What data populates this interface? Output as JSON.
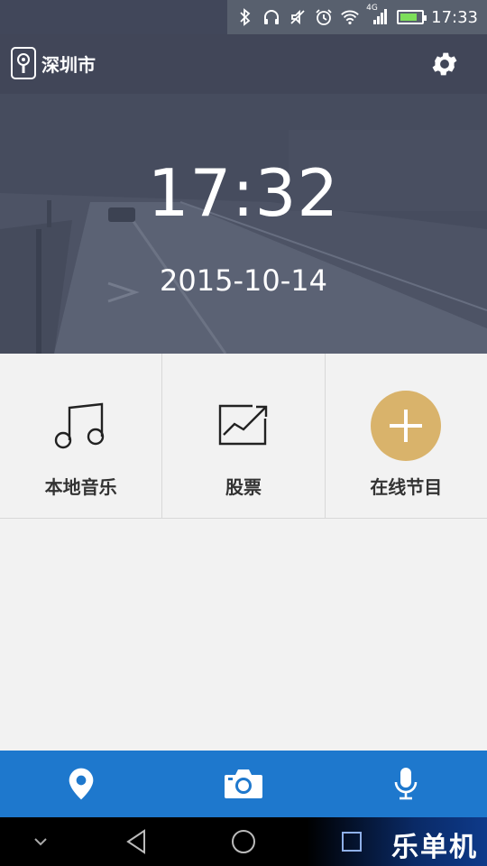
{
  "status_bar": {
    "time": "17:33",
    "network": "4G",
    "icons": [
      "bluetooth-icon",
      "headphones-icon",
      "mute-icon",
      "alarm-icon",
      "wifi-icon",
      "signal-icon",
      "battery-charging-icon"
    ]
  },
  "header": {
    "city": "深圳市",
    "settings_icon": "gear-icon"
  },
  "hero": {
    "time": "17:32",
    "date": "2015-10-14"
  },
  "tiles": [
    {
      "label": "本地音乐",
      "icon": "music-note-icon"
    },
    {
      "label": "股票",
      "icon": "stock-chart-icon"
    },
    {
      "label": "在线节目",
      "icon": "add-icon"
    }
  ],
  "action_bar": {
    "items": [
      "location-pin-icon",
      "camera-icon",
      "microphone-icon"
    ]
  },
  "nav_bar": {
    "items": [
      "chevron-down-icon",
      "back-icon",
      "home-icon",
      "recents-icon"
    ],
    "watermark": "乐单机"
  },
  "colors": {
    "header_bg": "#414658",
    "accent_blue": "#1e78cd",
    "add_circle": "#d9b36b"
  }
}
